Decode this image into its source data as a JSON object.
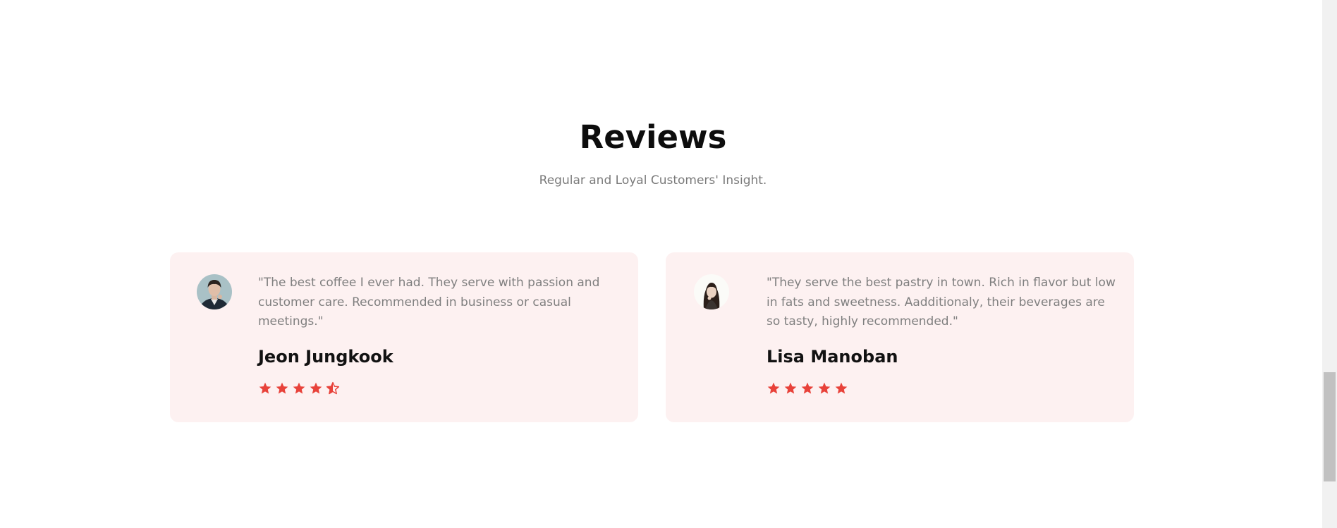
{
  "section": {
    "title": "Reviews",
    "subtitle": "Regular and Loyal Customers' Insight."
  },
  "reviews": [
    {
      "quote": "\"The best coffee I ever had. They serve with passion and customer care. Recommended in business or casual meetings.\"",
      "name": "Jeon Jungkook",
      "rating": 4.5
    },
    {
      "quote": "\"They serve the best pastry in town. Rich in flavor but low in fats and sweetness. Aadditionaly, their beverages are so tasty, highly recommended.\"",
      "name": "Lisa Manoban",
      "rating": 5
    }
  ],
  "colors": {
    "card_background": "#fdf1f1",
    "star": "#e8423a",
    "heading": "#0d0d0d",
    "body_text": "#7f7f7f"
  },
  "icons": {
    "star_full": "star-icon",
    "star_half": "star-half-icon"
  }
}
